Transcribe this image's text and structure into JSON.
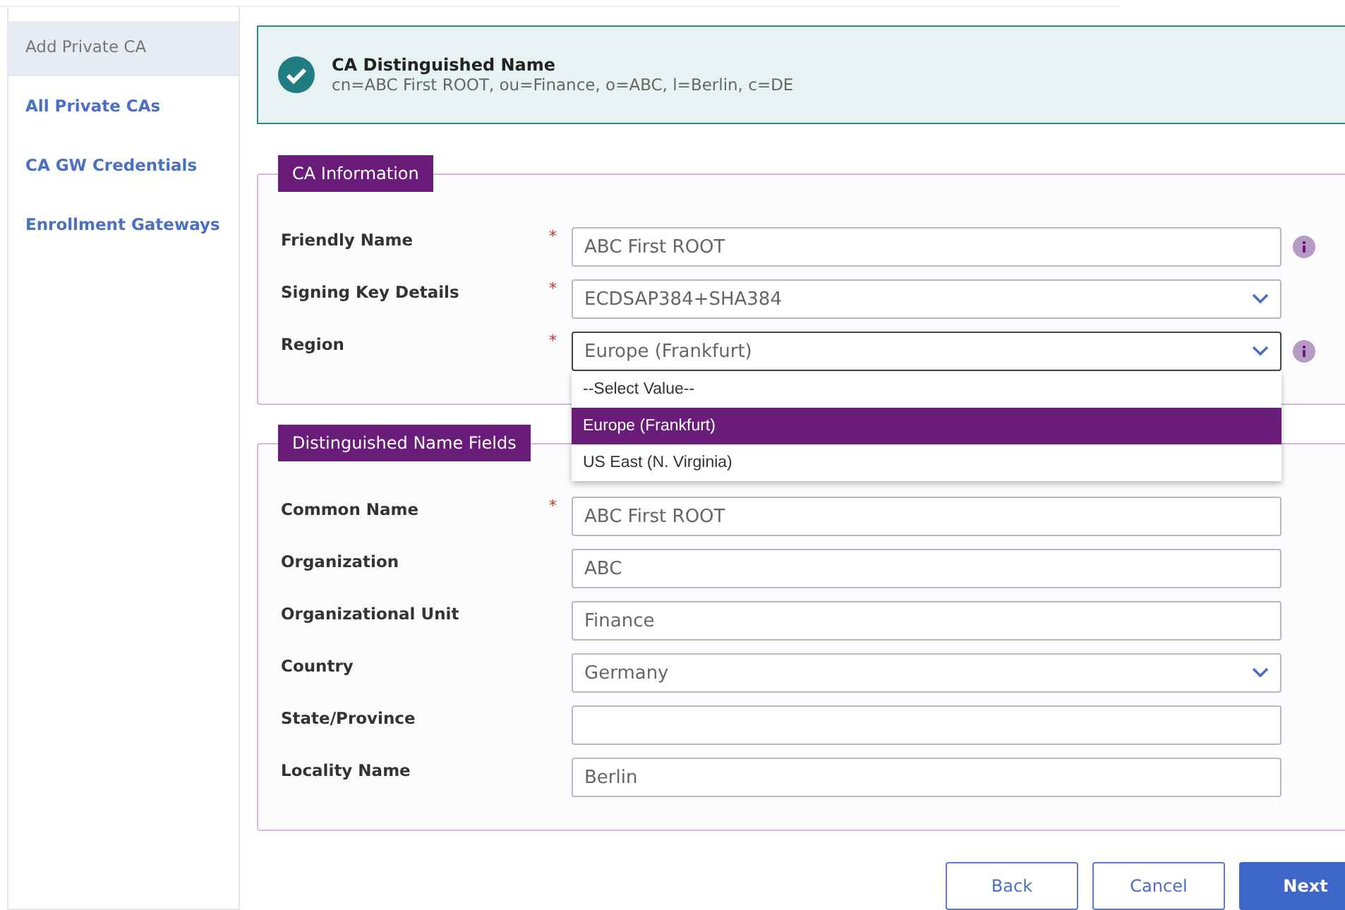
{
  "sidebar": {
    "items": [
      {
        "label": "Add Private CA",
        "selected": true
      },
      {
        "label": "All Private CAs",
        "selected": false
      },
      {
        "label": "CA GW Credentials",
        "selected": false
      },
      {
        "label": "Enrollment Gateways",
        "selected": false
      }
    ]
  },
  "banner": {
    "title": "CA Distinguished Name",
    "value": "cn=ABC First ROOT, ou=Finance, o=ABC, l=Berlin, c=DE"
  },
  "sections": [
    {
      "legend": "CA Information",
      "fields": [
        {
          "label": "Friendly Name",
          "required_mark": "*",
          "kind": "text",
          "value": "ABC First ROOT",
          "info": true
        },
        {
          "label": "Signing Key Details",
          "required_mark": "*",
          "kind": "select",
          "value": "ECDSAP384+SHA384"
        },
        {
          "label": "Region",
          "required_mark": "*",
          "kind": "select",
          "value": "Europe (Frankfurt)",
          "info": true,
          "focused": true,
          "options": [
            {
              "label": "--Select Value--",
              "selected": false
            },
            {
              "label": "Europe (Frankfurt)",
              "selected": true
            },
            {
              "label": "US East (N. Virginia)",
              "selected": false
            }
          ]
        }
      ]
    },
    {
      "legend": "Distinguished Name Fields",
      "fields": [
        {
          "label": "Common Name",
          "required_mark": "*",
          "kind": "text",
          "value": "ABC First ROOT"
        },
        {
          "label": "Organization",
          "kind": "text",
          "value": "ABC"
        },
        {
          "label": "Organizational Unit",
          "kind": "text",
          "value": "Finance"
        },
        {
          "label": "Country",
          "kind": "select",
          "value": "Germany"
        },
        {
          "label": "State/Province",
          "kind": "text"
        },
        {
          "label": "Locality Name",
          "kind": "text",
          "value": "Berlin"
        }
      ]
    }
  ],
  "buttons": [
    {
      "label": "Back",
      "kind": "secondary"
    },
    {
      "label": "Cancel",
      "kind": "secondary"
    },
    {
      "label": "Next",
      "kind": "primary"
    }
  ]
}
